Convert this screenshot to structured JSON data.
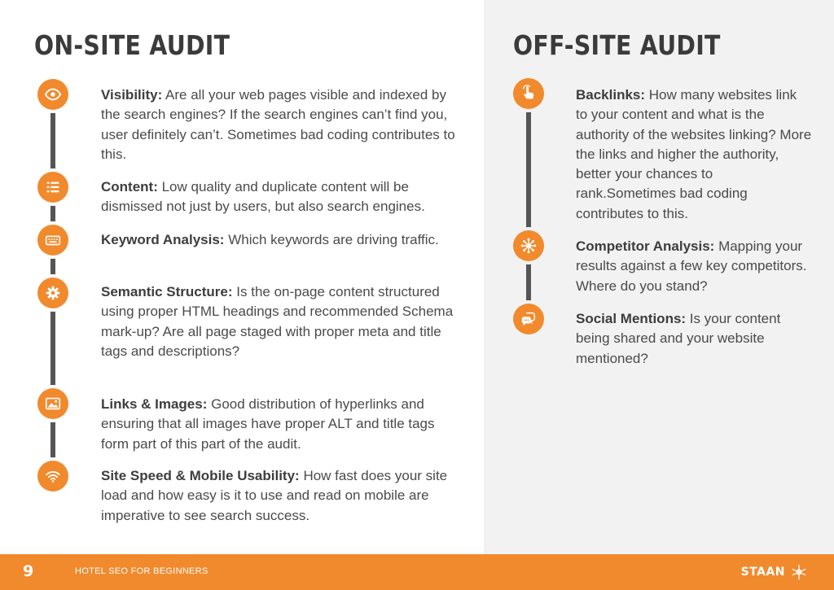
{
  "on_site": {
    "title": "ON-SITE AUDIT",
    "items": [
      {
        "icon": "eye-icon",
        "term": "Visibility:",
        "text": " Are all your web pages visible and indexed by the search engines? If the search engines can’t find you, user definitely can’t. Sometimes bad coding contributes to this."
      },
      {
        "icon": "list-icon",
        "term": "Content:",
        "text": " Low quality and duplicate content will be dismissed not just by users, but also search engines."
      },
      {
        "icon": "keyboard-icon",
        "term": "Keyword Analysis:",
        "text": " Which keywords are driving traffic."
      },
      {
        "icon": "gear-icon",
        "term": "Semantic Structure:",
        "text": " Is the on-page content structured using proper HTML headings and recommended Schema mark-up? Are all page staged with proper meta and title tags and descriptions?"
      },
      {
        "icon": "image-icon",
        "term": "Links & Images:",
        "text": " Good distribution of hyperlinks and ensuring that all images have proper ALT and title tags form part of this part of the audit."
      },
      {
        "icon": "wifi-icon",
        "term": "Site Speed & Mobile Usability:",
        "text": " How fast does your site load and how easy is it to use and read on mobile are imperative to see search success."
      }
    ]
  },
  "off_site": {
    "title": "OFF-SITE AUDIT",
    "items": [
      {
        "icon": "hand-pointer-icon",
        "term": "Backlinks:",
        "text": " How many websites link to your content and what is the authority of the websites linking? More the links and higher the authority, better your chances to rank.Sometimes bad coding contributes to this."
      },
      {
        "icon": "network-icon",
        "term": "Competitor Analysis:",
        "text": " Mapping your results against a few key competitors. Where do you stand?"
      },
      {
        "icon": "chat-icon",
        "term": "Social Mentions:",
        "text": " Is your content being shared and your website mentioned?"
      }
    ]
  },
  "footer": {
    "page_number": "9",
    "title": "HOTEL SEO FOR BEGINNERS",
    "brand": "STAAN"
  },
  "colors": {
    "accent": "#f18a2d",
    "timeline": "#555555",
    "right_panel_bg": "#f2f2f2"
  }
}
